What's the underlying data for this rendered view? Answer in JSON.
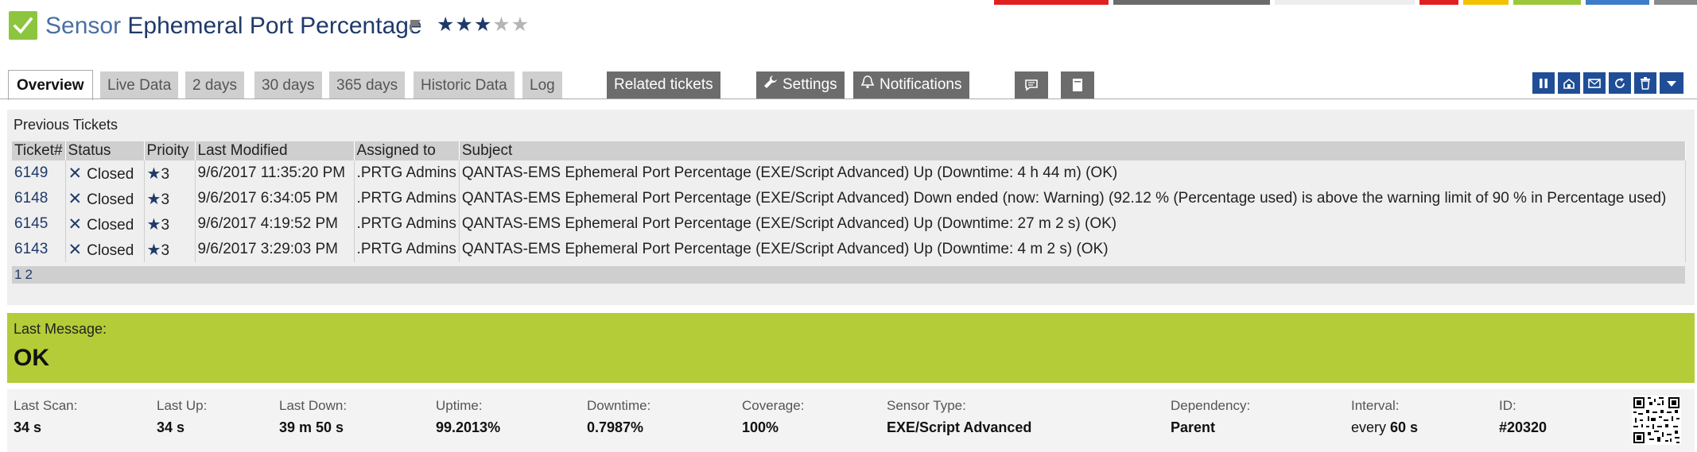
{
  "colors": {
    "brand": "#1f3a6a",
    "accent_blue": "#1f4e96",
    "status_ok": "#8cc63f",
    "last_message_bg": "#b3cc38",
    "tab_bg": "#cfcfcf",
    "dark_tab_bg": "#6c6c6c",
    "top_strip": [
      "#e02020",
      "#6b6b6b",
      "#eeeeee",
      "#e02020",
      "#f2c200",
      "#9bc83a",
      "#3d7cc9",
      "#8a8a8a"
    ]
  },
  "header": {
    "status_icon": "check-icon",
    "title_prefix": "Sensor",
    "title_name": "Ephemeral Port Percentage",
    "flag_icon": "flag-icon",
    "priority_stars": {
      "filled": 3,
      "total": 5
    }
  },
  "tabs": [
    {
      "label": "Overview",
      "active": true
    },
    {
      "label": "Live Data"
    },
    {
      "label": "2 days"
    },
    {
      "label": "30 days"
    },
    {
      "label": "365 days"
    },
    {
      "label": "Historic Data"
    },
    {
      "label": "Log"
    }
  ],
  "dark_tabs": {
    "related_tickets": "Related tickets",
    "settings": "Settings",
    "notifications": "Notifications"
  },
  "toolbar_icons": [
    "comment-icon",
    "notes-icon"
  ],
  "right_actions": [
    "pause-icon",
    "clone-icon",
    "email-icon",
    "refresh-icon",
    "delete-icon",
    "dropdown-icon"
  ],
  "tickets": {
    "section_title": "Previous Tickets",
    "columns": [
      "Ticket#",
      "Status",
      "Prioity",
      "Last Modified",
      "Assigned to",
      "Subject"
    ],
    "rows": [
      {
        "id": "6149",
        "status": "Closed",
        "priority": "3",
        "modified": "9/6/2017 11:35:20 PM",
        "assigned": ".PRTG Admins",
        "subject": "QANTAS-EMS Ephemeral Port Percentage (EXE/Script Advanced) Up (Downtime: 4 h 44 m) (OK)"
      },
      {
        "id": "6148",
        "status": "Closed",
        "priority": "3",
        "modified": "9/6/2017 6:34:05 PM",
        "assigned": ".PRTG Admins",
        "subject": "QANTAS-EMS Ephemeral Port Percentage (EXE/Script Advanced) Down ended (now: Warning) (92.12 % (Percentage used) is above the warning limit of 90 % in Percentage used)"
      },
      {
        "id": "6145",
        "status": "Closed",
        "priority": "3",
        "modified": "9/6/2017 4:19:52 PM",
        "assigned": ".PRTG Admins",
        "subject": "QANTAS-EMS Ephemeral Port Percentage (EXE/Script Advanced) Up (Downtime: 27 m 2 s) (OK)"
      },
      {
        "id": "6143",
        "status": "Closed",
        "priority": "3",
        "modified": "9/6/2017 3:29:03 PM",
        "assigned": ".PRTG Admins",
        "subject": "QANTAS-EMS Ephemeral Port Percentage (EXE/Script Advanced) Up (Downtime: 4 m 2 s) (OK)"
      }
    ],
    "pages": [
      "1",
      "2"
    ]
  },
  "last_message": {
    "label": "Last Message:",
    "value": "OK"
  },
  "stats": {
    "last_scan": {
      "label": "Last Scan:",
      "value": "34 s"
    },
    "last_up": {
      "label": "Last Up:",
      "value": "34 s"
    },
    "last_down": {
      "label": "Last Down:",
      "value": "39 m 50 s"
    },
    "uptime": {
      "label": "Uptime:",
      "value": "99.2013%"
    },
    "downtime": {
      "label": "Downtime:",
      "value": "0.7987%"
    },
    "coverage": {
      "label": "Coverage:",
      "value": "100%"
    },
    "sensor_type": {
      "label": "Sensor Type:",
      "value": "EXE/Script Advanced"
    },
    "dependency": {
      "label": "Dependency:",
      "value": "Parent"
    },
    "interval": {
      "label": "Interval:",
      "prefix": "every",
      "value": "60 s"
    },
    "id": {
      "label": "ID:",
      "value": "#20320"
    }
  },
  "qr_icon": "qr-code-icon"
}
